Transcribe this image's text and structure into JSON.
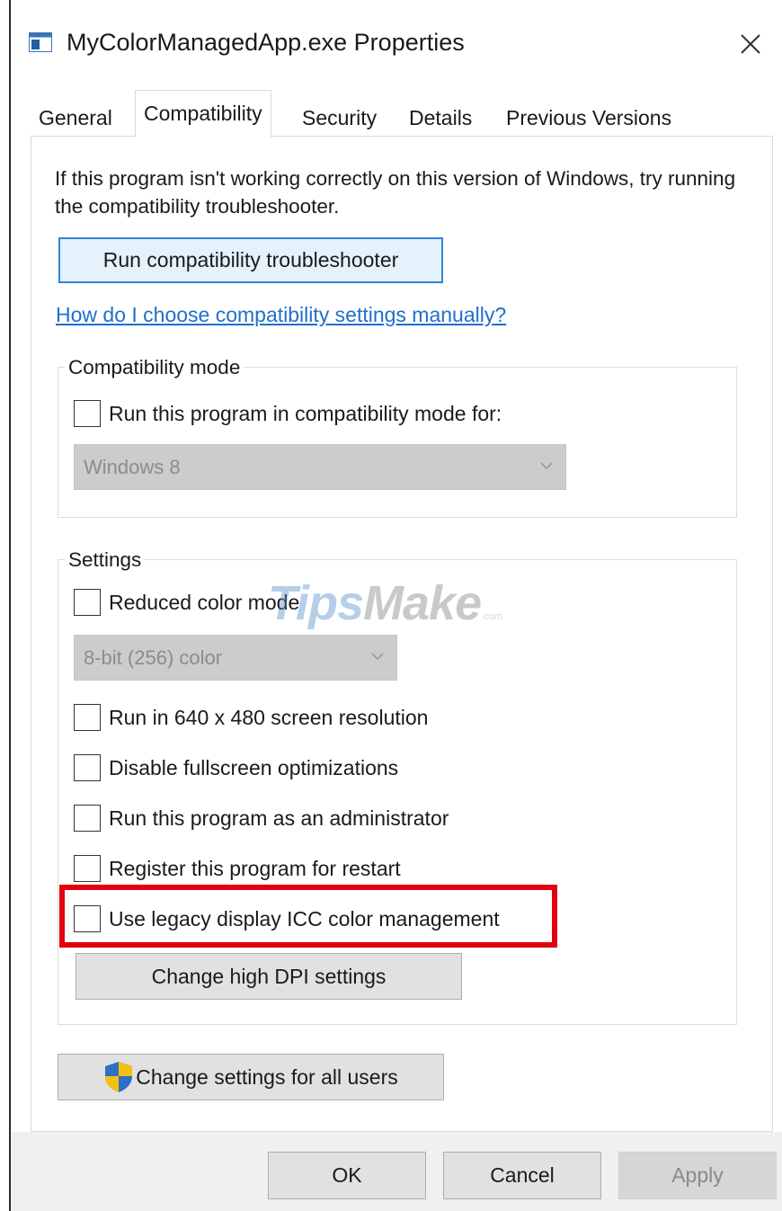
{
  "window": {
    "title": "MyColorManagedApp.exe Properties"
  },
  "tabs": [
    {
      "label": "General",
      "active": false
    },
    {
      "label": "Compatibility",
      "active": true
    },
    {
      "label": "Security",
      "active": false
    },
    {
      "label": "Details",
      "active": false
    },
    {
      "label": "Previous Versions",
      "active": false
    }
  ],
  "compat_page": {
    "intro_text": "If this program isn't working correctly on this version of Windows, try running the compatibility troubleshooter.",
    "troubleshooter_button": "Run compatibility troubleshooter",
    "help_link": "How do I choose compatibility settings manually?",
    "compatibility_mode": {
      "group_label": "Compatibility mode",
      "checkbox_label": "Run this program in compatibility mode for:",
      "checked": false,
      "os_select_value": "Windows 8"
    },
    "settings": {
      "group_label": "Settings",
      "reduced_color": {
        "label": "Reduced color mode",
        "checked": false
      },
      "color_select_value": "8-bit (256) color",
      "resolution": {
        "label": "Run in 640 x 480 screen resolution",
        "checked": false
      },
      "fullscreen_opt": {
        "label": "Disable fullscreen optimizations",
        "checked": false
      },
      "run_as_admin": {
        "label": "Run this program as an administrator",
        "checked": false
      },
      "register_restart": {
        "label": "Register this program for restart",
        "checked": false
      },
      "legacy_icc": {
        "label": "Use legacy display ICC color management",
        "checked": false,
        "highlighted": true
      },
      "high_dpi_button": "Change high DPI settings"
    },
    "all_users_button": "Change settings for all users"
  },
  "footer": {
    "ok_label": "OK",
    "cancel_label": "Cancel",
    "apply_label": "Apply",
    "apply_enabled": false
  },
  "watermark": {
    "part1": "Tips",
    "part2": "Make",
    "part3": ".com"
  },
  "colors": {
    "accent_link": "#1f6fc9",
    "default_button_border": "#2f86d6",
    "highlight_box": "#e3000f",
    "disabled_dropdown": "#cccccc",
    "footer_bg": "#f0f0f0"
  },
  "icons": {
    "app": "app-window-icon",
    "close": "close-icon",
    "uac": "uac-shield-icon",
    "dropdown": "chevron-down-icon"
  }
}
